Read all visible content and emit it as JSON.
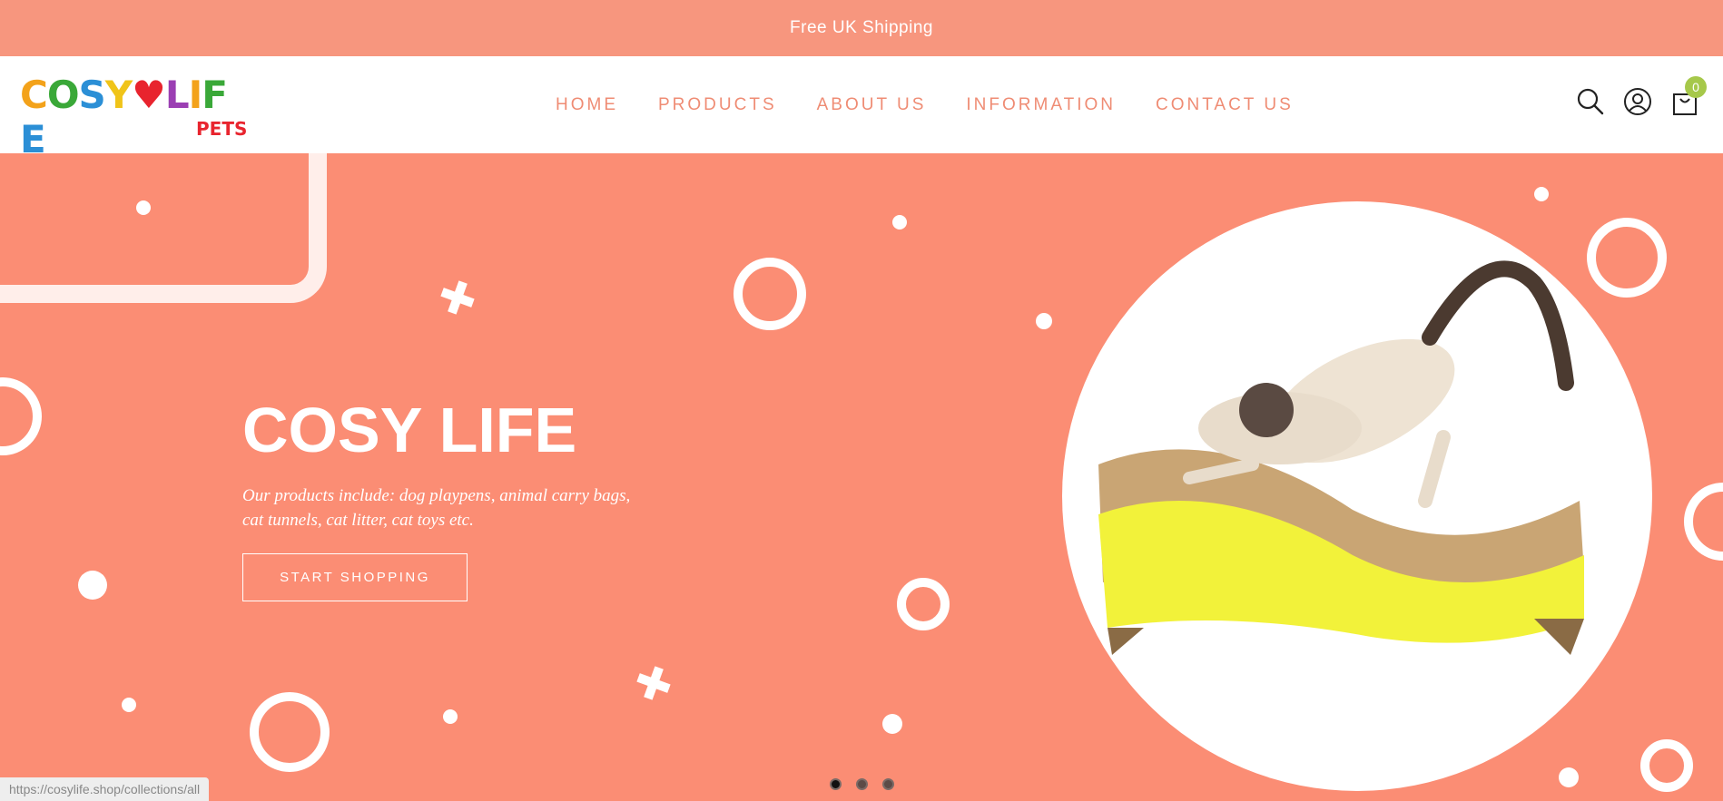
{
  "announcement": "Free UK Shipping",
  "logo": {
    "text": "COSYLIFE",
    "sub": "PETS"
  },
  "nav": [
    "HOME",
    "PRODUCTS",
    "ABOUT US",
    "INFORMATION",
    "CONTACT US"
  ],
  "header_icons": [
    "search-icon",
    "account-icon",
    "cart-icon"
  ],
  "cart_count": "0",
  "hero": {
    "title": "COSY LIFE",
    "description": "Our products include: dog playpens, animal carry bags, cat tunnels, cat litter, cat toys etc.",
    "button": "START SHOPPING"
  },
  "slider_dots": 3,
  "status_url": "https://cosylife.shop/collections/all",
  "colors": {
    "announce_bg": "#f7967e",
    "hero_bg": "#fb8d74",
    "nav_text": "#ef8c74",
    "badge": "#a6c84a"
  }
}
